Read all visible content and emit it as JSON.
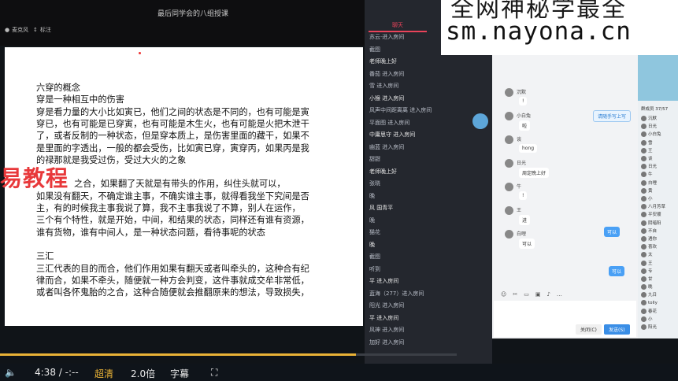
{
  "window": {
    "title": "最后同学会的八组授课",
    "toolbar": [
      {
        "icon": "mic-icon",
        "label": "麦克风"
      },
      {
        "icon": "pin-icon",
        "label": "标注"
      }
    ]
  },
  "document": {
    "lines": [
      "六穿的概念",
      "穿是一种相互中的伤害",
      "穿是看力量的大小比如寅已，他们之间的状态是不同的，也有可能是寅",
      "穿已，也有可能是已穿寅，也有可能是木生火，也有可能是火把木泄干",
      "了，或者反制的一种状态，但是穿本质上，是伤害里面的藏干，如果不",
      "是里面的字透出，一般的都会受伤，比如寅已穿，寅穿丙，如果丙是我",
      "的禄那就是我受过伤，受过大火的之象",
      "",
      "之合，如果翻了天就是有带头的作用，纠住头就可以，",
      "如果没有翻天，不确定谁主事，不确实谁主事，就得看我坐下究间是否",
      "主，有的时候我主事我说了算，我不主事我说了不算，别人在运作，",
      "三个有个特性，就是开始，中间，和结果的状态，同样还有谁有资源，",
      "谁有货物，谁有中间人，是一种状态问题，看待事呢的状态",
      "",
      "三汇",
      "三汇代表的目的而合，他们作用如果有翻天或者叫牵头的，这种合有纪",
      "律而合，如果不牵头，随便就一种方会判变，这件事就成交牟非常低，",
      "或者叫各怀鬼胎的之合，这种合随便就会推翻原来的想法，导致损失，"
    ]
  },
  "watermark_left": "易教程",
  "watermark_box": {
    "line1": "全网神秘学最全",
    "line2": "sm.nayona.cn"
  },
  "mid_chat": {
    "tab": "聊天",
    "entries": [
      "苏云·进入房间",
      "截图",
      "老师晚上好",
      "番茄 进入房间",
      "雪 进入房间",
      "小猴 进入房间",
      "风声中间距离离 进入房间",
      "平面图 进入房间",
      "中庸思守 进入房间",
      "幽蓝 进入房间",
      "甜甜",
      "老师晚上好",
      "张晓",
      "晚",
      "风   国青平",
      "晚",
      "猫花",
      "晚",
      "截图",
      "听到",
      "平 进入房间",
      "蓝海（277）进入房间",
      "阳光 进入房间",
      "平 进入房间",
      "风神 进入房间",
      "加好 进入房间"
    ]
  },
  "chat_window": {
    "messages": [
      {
        "name": "沉默",
        "text": "!"
      },
      {
        "name": "小白兔",
        "text": "啦"
      },
      {
        "name": "谈",
        "text": "hong"
      },
      {
        "name": "日光",
        "text": "周定晚上好"
      },
      {
        "name": "牛",
        "text": "!"
      },
      {
        "name": "王",
        "text": "进"
      },
      {
        "name": "白哩",
        "text": "可以"
      }
    ],
    "my_messages": [
      "可以",
      "可以"
    ],
    "quick_reply": "请随手写上写",
    "cancel_label": "关闭(C)",
    "send_label": "发送(S)"
  },
  "member_list": {
    "header": "群成员 37/57",
    "members": [
      "沉默",
      "日光",
      "小白兔",
      "雪",
      "王",
      "谈",
      "日光",
      "牛",
      "白哩",
      "黄",
      "小",
      "八月芳草",
      "平安顺",
      "阴暗阳",
      "不自",
      "遇你",
      "喜欢",
      "太",
      "王",
      "专",
      "甘",
      "晚",
      "九日",
      "tolly",
      "春花",
      "小",
      "阳光"
    ]
  },
  "player": {
    "time": "4:38 / -:--",
    "quality": "超清",
    "speed": "2.0倍",
    "subtitle": "字幕",
    "progress": 0.78
  },
  "colors": {
    "accent": "#e9435a",
    "progress": "#e9b236",
    "brand_blue": "#4aa0f5"
  }
}
